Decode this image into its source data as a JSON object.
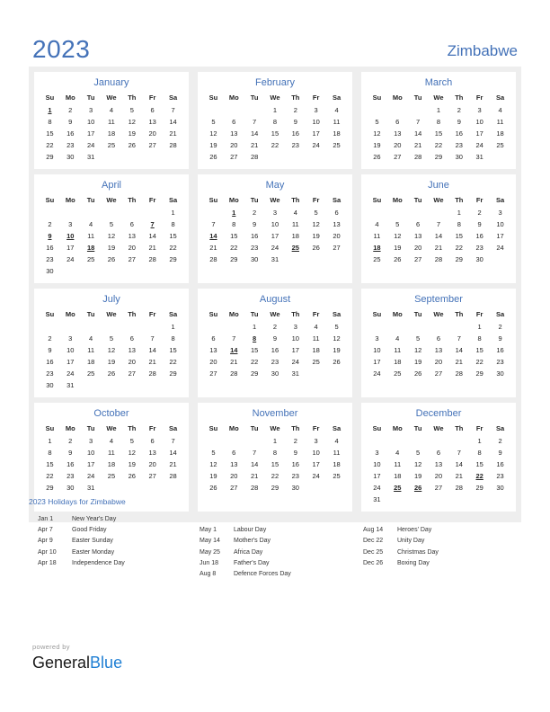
{
  "header": {
    "year": "2023",
    "country": "Zimbabwe",
    "accent_color": "#4472b8",
    "holiday_color": "#e60000"
  },
  "weekday_headers": [
    "Su",
    "Mo",
    "Tu",
    "We",
    "Th",
    "Fr",
    "Sa"
  ],
  "months": [
    {
      "name": "January",
      "weeks": [
        [
          "1",
          "2",
          "3",
          "4",
          "5",
          "6",
          "7"
        ],
        [
          "8",
          "9",
          "10",
          "11",
          "12",
          "13",
          "14"
        ],
        [
          "15",
          "16",
          "17",
          "18",
          "19",
          "20",
          "21"
        ],
        [
          "22",
          "23",
          "24",
          "25",
          "26",
          "27",
          "28"
        ],
        [
          "29",
          "30",
          "31",
          "",
          "",
          "",
          ""
        ]
      ],
      "holidays": [
        "1"
      ]
    },
    {
      "name": "February",
      "weeks": [
        [
          "",
          "",
          "",
          "1",
          "2",
          "3",
          "4"
        ],
        [
          "5",
          "6",
          "7",
          "8",
          "9",
          "10",
          "11"
        ],
        [
          "12",
          "13",
          "14",
          "15",
          "16",
          "17",
          "18"
        ],
        [
          "19",
          "20",
          "21",
          "22",
          "23",
          "24",
          "25"
        ],
        [
          "26",
          "27",
          "28",
          "",
          "",
          "",
          ""
        ]
      ],
      "holidays": []
    },
    {
      "name": "March",
      "weeks": [
        [
          "",
          "",
          "",
          "1",
          "2",
          "3",
          "4"
        ],
        [
          "5",
          "6",
          "7",
          "8",
          "9",
          "10",
          "11"
        ],
        [
          "12",
          "13",
          "14",
          "15",
          "16",
          "17",
          "18"
        ],
        [
          "19",
          "20",
          "21",
          "22",
          "23",
          "24",
          "25"
        ],
        [
          "26",
          "27",
          "28",
          "29",
          "30",
          "31",
          ""
        ]
      ],
      "holidays": []
    },
    {
      "name": "April",
      "weeks": [
        [
          "",
          "",
          "",
          "",
          "",
          "",
          "1"
        ],
        [
          "2",
          "3",
          "4",
          "5",
          "6",
          "7",
          "8"
        ],
        [
          "9",
          "10",
          "11",
          "12",
          "13",
          "14",
          "15"
        ],
        [
          "16",
          "17",
          "18",
          "19",
          "20",
          "21",
          "22"
        ],
        [
          "23",
          "24",
          "25",
          "26",
          "27",
          "28",
          "29"
        ],
        [
          "30",
          "",
          "",
          "",
          "",
          "",
          ""
        ]
      ],
      "holidays": [
        "7",
        "9",
        "10",
        "18"
      ]
    },
    {
      "name": "May",
      "weeks": [
        [
          "",
          "1",
          "2",
          "3",
          "4",
          "5",
          "6"
        ],
        [
          "7",
          "8",
          "9",
          "10",
          "11",
          "12",
          "13"
        ],
        [
          "14",
          "15",
          "16",
          "17",
          "18",
          "19",
          "20"
        ],
        [
          "21",
          "22",
          "23",
          "24",
          "25",
          "26",
          "27"
        ],
        [
          "28",
          "29",
          "30",
          "31",
          "",
          "",
          ""
        ]
      ],
      "holidays": [
        "1",
        "14",
        "25"
      ]
    },
    {
      "name": "June",
      "weeks": [
        [
          "",
          "",
          "",
          "",
          "1",
          "2",
          "3"
        ],
        [
          "4",
          "5",
          "6",
          "7",
          "8",
          "9",
          "10"
        ],
        [
          "11",
          "12",
          "13",
          "14",
          "15",
          "16",
          "17"
        ],
        [
          "18",
          "19",
          "20",
          "21",
          "22",
          "23",
          "24"
        ],
        [
          "25",
          "26",
          "27",
          "28",
          "29",
          "30",
          ""
        ]
      ],
      "holidays": [
        "18"
      ]
    },
    {
      "name": "July",
      "weeks": [
        [
          "",
          "",
          "",
          "",
          "",
          "",
          "1"
        ],
        [
          "2",
          "3",
          "4",
          "5",
          "6",
          "7",
          "8"
        ],
        [
          "9",
          "10",
          "11",
          "12",
          "13",
          "14",
          "15"
        ],
        [
          "16",
          "17",
          "18",
          "19",
          "20",
          "21",
          "22"
        ],
        [
          "23",
          "24",
          "25",
          "26",
          "27",
          "28",
          "29"
        ],
        [
          "30",
          "31",
          "",
          "",
          "",
          "",
          ""
        ]
      ],
      "holidays": []
    },
    {
      "name": "August",
      "weeks": [
        [
          "",
          "",
          "1",
          "2",
          "3",
          "4",
          "5"
        ],
        [
          "6",
          "7",
          "8",
          "9",
          "10",
          "11",
          "12"
        ],
        [
          "13",
          "14",
          "15",
          "16",
          "17",
          "18",
          "19"
        ],
        [
          "20",
          "21",
          "22",
          "23",
          "24",
          "25",
          "26"
        ],
        [
          "27",
          "28",
          "29",
          "30",
          "31",
          "",
          ""
        ]
      ],
      "holidays": [
        "8",
        "14"
      ]
    },
    {
      "name": "September",
      "weeks": [
        [
          "",
          "",
          "",
          "",
          "",
          "1",
          "2"
        ],
        [
          "3",
          "4",
          "5",
          "6",
          "7",
          "8",
          "9"
        ],
        [
          "10",
          "11",
          "12",
          "13",
          "14",
          "15",
          "16"
        ],
        [
          "17",
          "18",
          "19",
          "20",
          "21",
          "22",
          "23"
        ],
        [
          "24",
          "25",
          "26",
          "27",
          "28",
          "29",
          "30"
        ]
      ],
      "holidays": []
    },
    {
      "name": "October",
      "weeks": [
        [
          "1",
          "2",
          "3",
          "4",
          "5",
          "6",
          "7"
        ],
        [
          "8",
          "9",
          "10",
          "11",
          "12",
          "13",
          "14"
        ],
        [
          "15",
          "16",
          "17",
          "18",
          "19",
          "20",
          "21"
        ],
        [
          "22",
          "23",
          "24",
          "25",
          "26",
          "27",
          "28"
        ],
        [
          "29",
          "30",
          "31",
          "",
          "",
          "",
          ""
        ]
      ],
      "holidays": []
    },
    {
      "name": "November",
      "weeks": [
        [
          "",
          "",
          "",
          "1",
          "2",
          "3",
          "4"
        ],
        [
          "5",
          "6",
          "7",
          "8",
          "9",
          "10",
          "11"
        ],
        [
          "12",
          "13",
          "14",
          "15",
          "16",
          "17",
          "18"
        ],
        [
          "19",
          "20",
          "21",
          "22",
          "23",
          "24",
          "25"
        ],
        [
          "26",
          "27",
          "28",
          "29",
          "30",
          "",
          ""
        ]
      ],
      "holidays": []
    },
    {
      "name": "December",
      "weeks": [
        [
          "",
          "",
          "",
          "",
          "",
          "1",
          "2"
        ],
        [
          "3",
          "4",
          "5",
          "6",
          "7",
          "8",
          "9"
        ],
        [
          "10",
          "11",
          "12",
          "13",
          "14",
          "15",
          "16"
        ],
        [
          "17",
          "18",
          "19",
          "20",
          "21",
          "22",
          "23"
        ],
        [
          "24",
          "25",
          "26",
          "27",
          "28",
          "29",
          "30"
        ],
        [
          "31",
          "",
          "",
          "",
          "",
          "",
          ""
        ]
      ],
      "holidays": [
        "22",
        "25",
        "26"
      ]
    }
  ],
  "holidays_section": {
    "title": "2023 Holidays for Zimbabwe",
    "columns": [
      [
        {
          "date": "Jan 1",
          "name": "New Year's Day"
        },
        {
          "date": "Apr 7",
          "name": "Good Friday"
        },
        {
          "date": "Apr 9",
          "name": "Easter Sunday"
        },
        {
          "date": "Apr 10",
          "name": "Easter Monday"
        },
        {
          "date": "Apr 18",
          "name": "Independence Day"
        }
      ],
      [
        {
          "date": "May 1",
          "name": "Labour Day"
        },
        {
          "date": "May 14",
          "name": "Mother's Day"
        },
        {
          "date": "May 25",
          "name": "Africa Day"
        },
        {
          "date": "Jun 18",
          "name": "Father's Day"
        },
        {
          "date": "Aug 8",
          "name": "Defence Forces Day"
        }
      ],
      [
        {
          "date": "Aug 14",
          "name": "Heroes' Day"
        },
        {
          "date": "Dec 22",
          "name": "Unity Day"
        },
        {
          "date": "Dec 25",
          "name": "Christmas Day"
        },
        {
          "date": "Dec 26",
          "name": "Boxing Day"
        }
      ]
    ],
    "column_offsets": [
      0,
      1,
      1
    ]
  },
  "footer": {
    "powered_by": "powered by",
    "logo_first": "General",
    "logo_second": "Blue"
  }
}
